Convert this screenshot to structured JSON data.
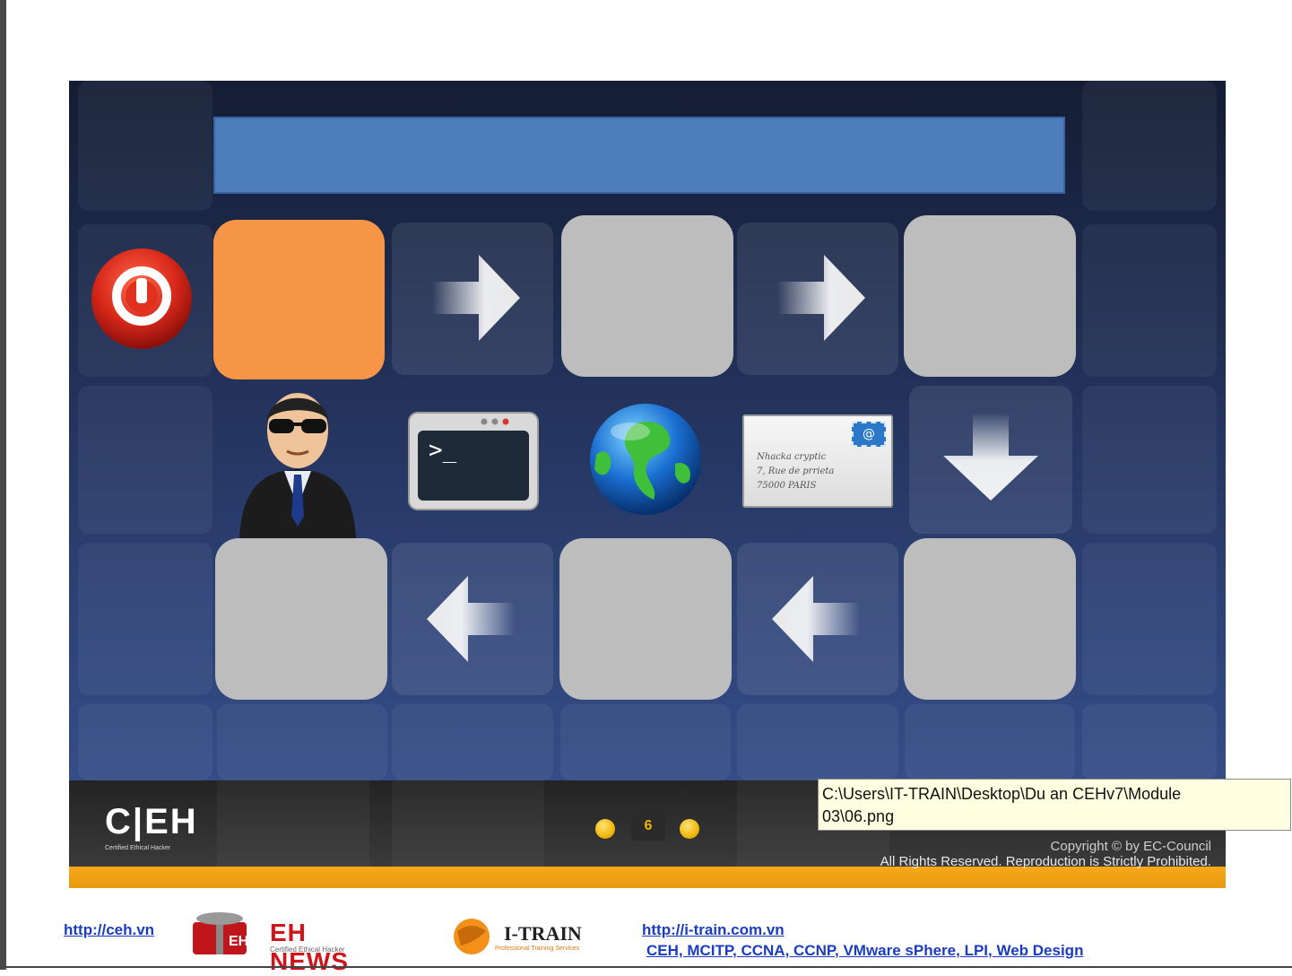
{
  "slide": {
    "page_number": "6",
    "copyright_line1": "Copyright © by EC-Council",
    "copyright_line2": "All Rights Reserved. Reproduction is Strictly Prohibited."
  },
  "ceh_logo": {
    "text": "C|EH",
    "subtext": "Certified Ethical Hacker"
  },
  "tooltip": {
    "line1": "C:\\Users\\IT-TRAIN\\Desktop\\Du an CEHv7\\Module",
    "line2": "03\\06.png"
  },
  "envelope": {
    "line1": "Nhacka cryptic",
    "line2": "7, Rue de prrieta",
    "line3": "75000 PARIS"
  },
  "footer": {
    "link_ceh": "http://ceh.vn",
    "ehnews_text": "EH NEWS",
    "ehnews_sub": "Certified Ethical Hacker",
    "itrain_text": "I-TRAIN",
    "itrain_sub": "Professional Training Services",
    "link_itrain": "http://i-train.com.vn",
    "courses": "CEH, MCITP, CCNA, CCNP, VMware sPhere, LPI, Web Design"
  },
  "colors": {
    "title_bar": "#4d7dbb",
    "orange_box": "#f69545",
    "gray_box": "#bdbdbd",
    "accent_orange": "#f7a91a",
    "tooltip_bg": "#ffffe1",
    "link": "#1a3cc5"
  },
  "icons": [
    "power-icon",
    "hacker-icon",
    "terminal-icon",
    "globe-icon",
    "envelope-icon",
    "arrow-right-icon",
    "arrow-down-icon",
    "arrow-left-icon"
  ]
}
